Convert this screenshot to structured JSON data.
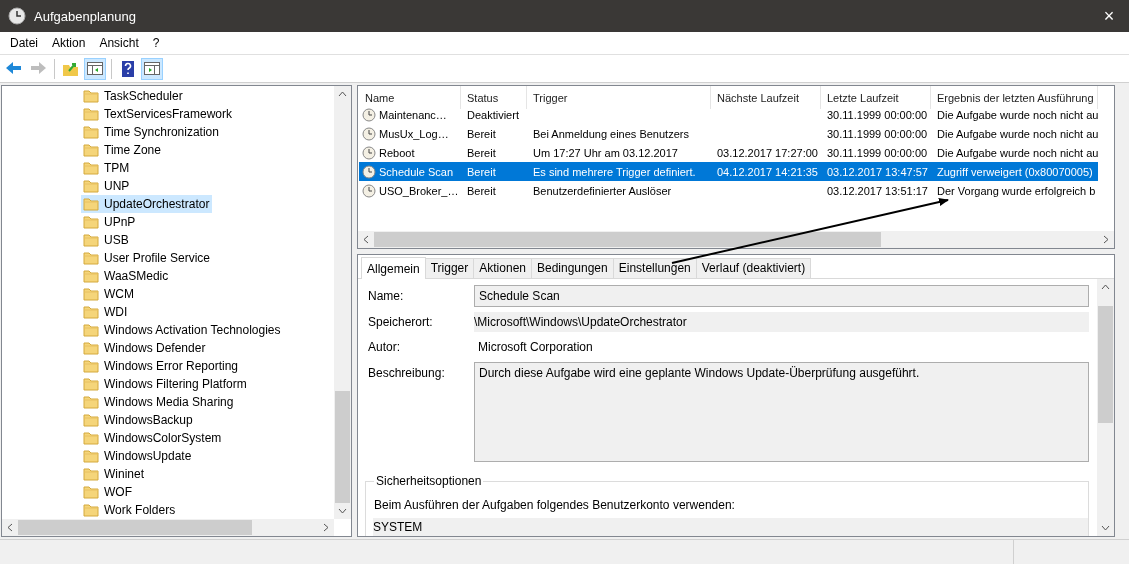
{
  "window": {
    "title": "Aufgabenplanung",
    "close": "×"
  },
  "menu": [
    "Datei",
    "Aktion",
    "Ansicht",
    "?"
  ],
  "toolbar": [
    {
      "kind": "back",
      "disabled": false,
      "pressed": false
    },
    {
      "kind": "forward",
      "disabled": true,
      "pressed": false
    },
    {
      "kind": "separator"
    },
    {
      "kind": "up",
      "disabled": false,
      "pressed": false
    },
    {
      "kind": "console_tree",
      "disabled": false,
      "pressed": true
    },
    {
      "kind": "separator"
    },
    {
      "kind": "help",
      "disabled": false,
      "pressed": false
    },
    {
      "kind": "action_pane",
      "disabled": false,
      "pressed": true
    }
  ],
  "tree": {
    "items": [
      {
        "label": "TaskScheduler",
        "selected": false
      },
      {
        "label": "TextServicesFramework",
        "selected": false
      },
      {
        "label": "Time Synchronization",
        "selected": false
      },
      {
        "label": "Time Zone",
        "selected": false
      },
      {
        "label": "TPM",
        "selected": false
      },
      {
        "label": "UNP",
        "selected": false
      },
      {
        "label": "UpdateOrchestrator",
        "selected": true
      },
      {
        "label": "UPnP",
        "selected": false
      },
      {
        "label": "USB",
        "selected": false
      },
      {
        "label": "User Profile Service",
        "selected": false
      },
      {
        "label": "WaaSMedic",
        "selected": false
      },
      {
        "label": "WCM",
        "selected": false
      },
      {
        "label": "WDI",
        "selected": false
      },
      {
        "label": "Windows Activation Technologies",
        "selected": false
      },
      {
        "label": "Windows Defender",
        "selected": false
      },
      {
        "label": "Windows Error Reporting",
        "selected": false
      },
      {
        "label": "Windows Filtering Platform",
        "selected": false
      },
      {
        "label": "Windows Media Sharing",
        "selected": false
      },
      {
        "label": "WindowsBackup",
        "selected": false
      },
      {
        "label": "WindowsColorSystem",
        "selected": false
      },
      {
        "label": "WindowsUpdate",
        "selected": false
      },
      {
        "label": "Wininet",
        "selected": false
      },
      {
        "label": "WOF",
        "selected": false
      },
      {
        "label": "Work Folders",
        "selected": false
      }
    ]
  },
  "task_table": {
    "columns": [
      "Name",
      "Status",
      "Trigger",
      "Nächste Laufzeit",
      "Letzte Laufzeit",
      "Ergebnis der letzten Ausführung"
    ],
    "rows": [
      {
        "cells": [
          "Maintenanc…",
          "Deaktiviert",
          "",
          "",
          "30.11.1999 00:00:00",
          "Die Aufgabe wurde noch nicht au"
        ],
        "selected": false
      },
      {
        "cells": [
          "MusUx_Log…",
          "Bereit",
          "Bei Anmeldung eines Benutzers",
          "",
          "30.11.1999 00:00:00",
          "Die Aufgabe wurde noch nicht au"
        ],
        "selected": false
      },
      {
        "cells": [
          "Reboot",
          "Bereit",
          "Um 17:27 Uhr am 03.12.2017",
          "03.12.2017 17:27:00",
          "30.11.1999 00:00:00",
          "Die Aufgabe wurde noch nicht au"
        ],
        "selected": false
      },
      {
        "cells": [
          "Schedule Scan",
          "Bereit",
          "Es sind mehrere Trigger definiert.",
          "04.12.2017 14:21:35",
          "03.12.2017 13:47:57",
          "Zugriff verweigert (0x80070005)"
        ],
        "selected": true
      },
      {
        "cells": [
          "USO_Broker_…",
          "Bereit",
          "Benutzerdefinierter Auslöser",
          "",
          "03.12.2017 13:51:17",
          "Der Vorgang wurde erfolgreich b"
        ],
        "selected": false
      }
    ]
  },
  "details": {
    "tabs": [
      {
        "label": "Allgemein",
        "selected": true
      },
      {
        "label": "Trigger",
        "selected": false
      },
      {
        "label": "Aktionen",
        "selected": false
      },
      {
        "label": "Bedingungen",
        "selected": false
      },
      {
        "label": "Einstellungen",
        "selected": false
      },
      {
        "label": "Verlauf (deaktiviert)",
        "selected": false
      }
    ],
    "fields": [
      {
        "kind": "box",
        "label": "Name:",
        "value": "Schedule Scan"
      },
      {
        "kind": "readonly",
        "label": "Speicherort:",
        "value": "\\Microsoft\\Windows\\UpdateOrchestrator"
      },
      {
        "kind": "plain",
        "label": "Autor:",
        "value": "Microsoft Corporation"
      },
      {
        "kind": "textarea",
        "label": "Beschreibung:",
        "value": "Durch diese Aufgabe wird eine geplante Windows Update-Überprüfung ausgeführt."
      }
    ],
    "security": {
      "title": "Sicherheitsoptionen",
      "prompt": "Beim Ausführen der Aufgaben folgendes Benutzerkonto verwenden:",
      "account": "SYSTEM"
    }
  }
}
